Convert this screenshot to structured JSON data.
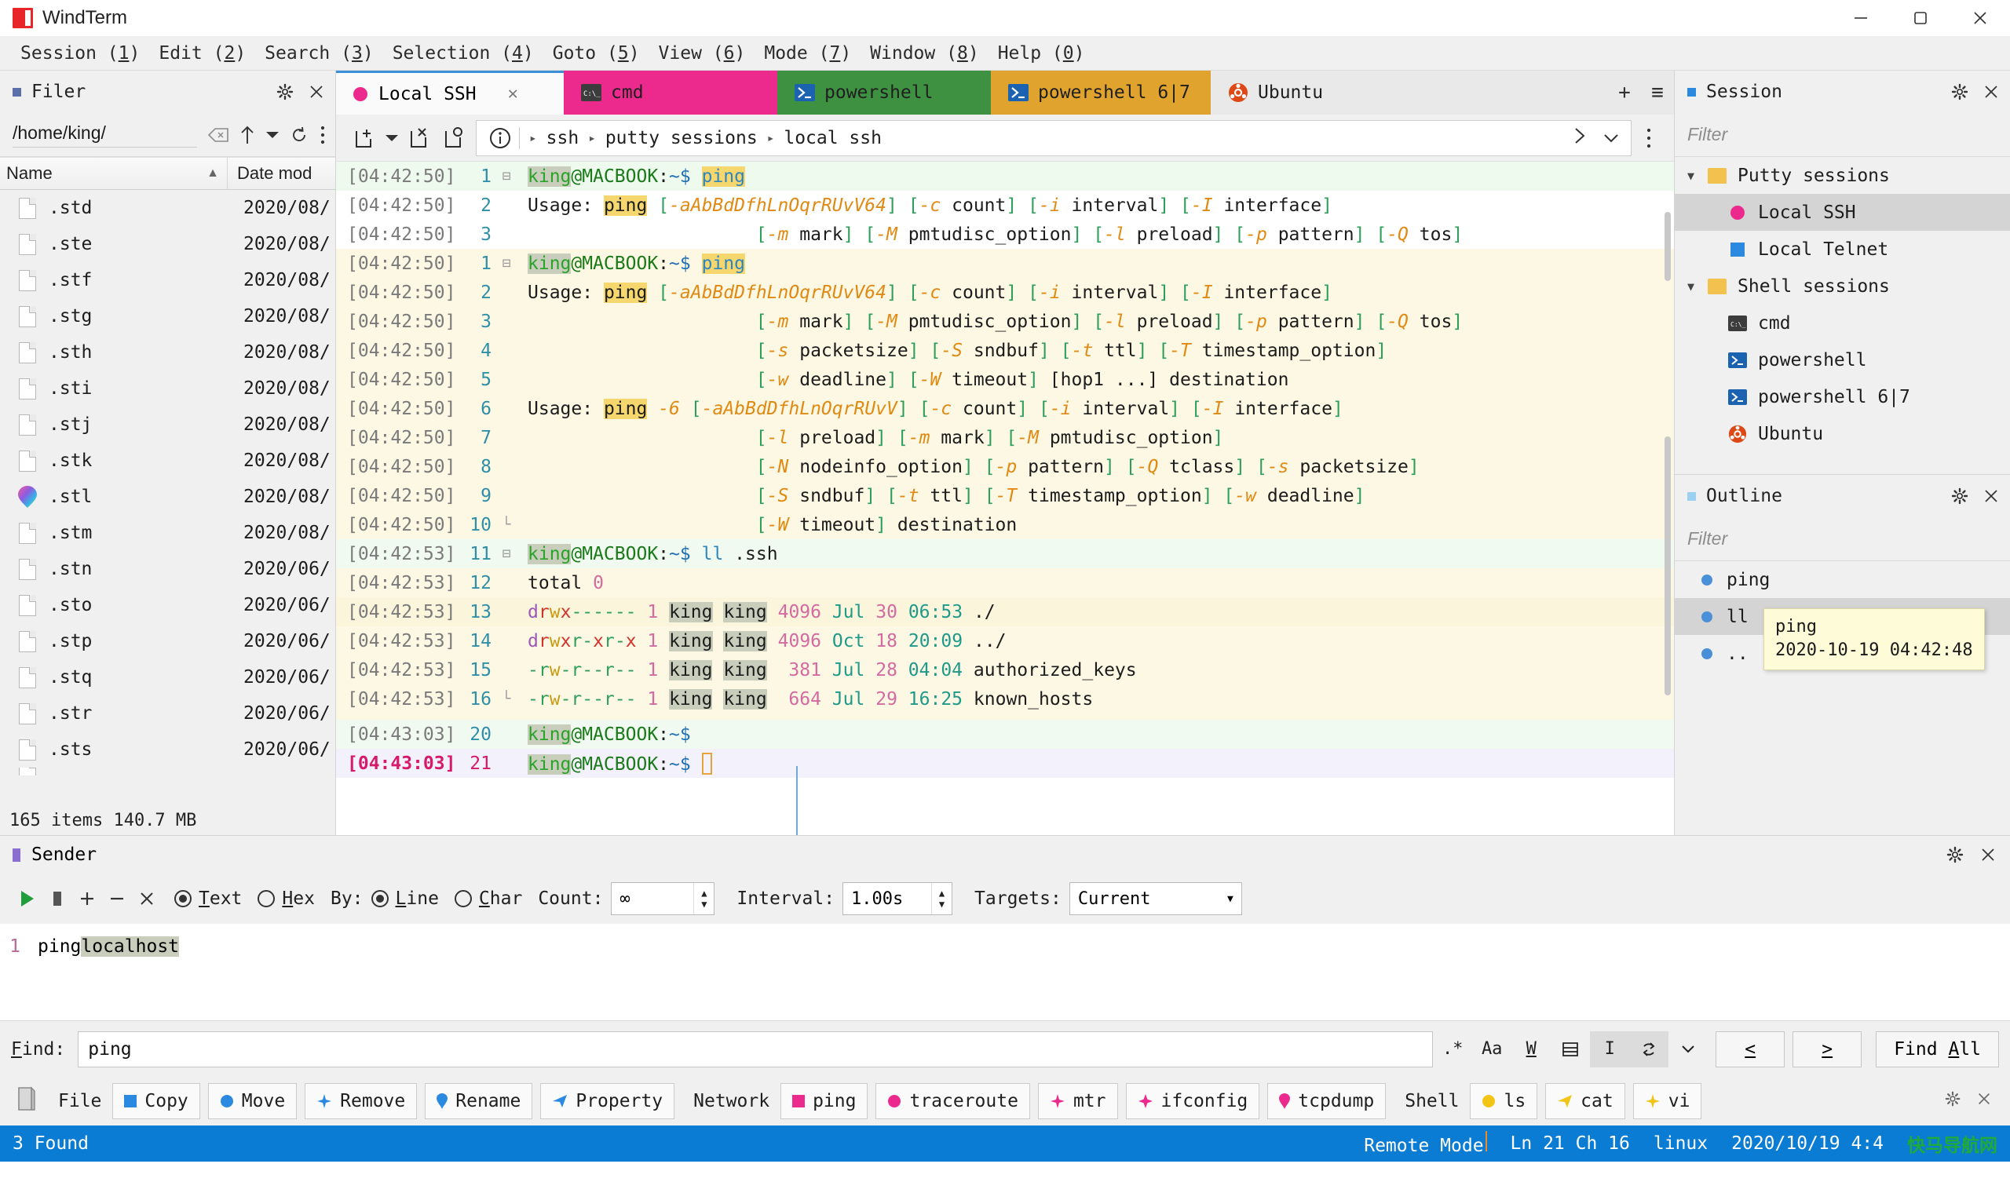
{
  "app": {
    "title": "WindTerm",
    "logo_icon": "windterm-logo-icon"
  },
  "window_controls": {
    "minimize": "minimize-icon",
    "maximize": "maximize-icon",
    "close": "close-icon"
  },
  "menubar": [
    {
      "label": "Session",
      "key": "1"
    },
    {
      "label": "Edit",
      "key": "2"
    },
    {
      "label": "Search",
      "key": "3"
    },
    {
      "label": "Selection",
      "key": "4"
    },
    {
      "label": "Goto",
      "key": "5"
    },
    {
      "label": "View",
      "key": "6"
    },
    {
      "label": "Mode",
      "key": "7"
    },
    {
      "label": "Window",
      "key": "8"
    },
    {
      "label": "Help",
      "key": "0"
    }
  ],
  "filer": {
    "title": "Filer",
    "path": "/home/king/",
    "columns": [
      "Name",
      "Date mod"
    ],
    "status": "165 items 140.7 MB",
    "files": [
      {
        "name": ".std",
        "date": "2020/08/",
        "icon": "file-icon"
      },
      {
        "name": ".ste",
        "date": "2020/08/",
        "icon": "file-icon"
      },
      {
        "name": ".stf",
        "date": "2020/08/",
        "icon": "file-icon"
      },
      {
        "name": ".stg",
        "date": "2020/08/",
        "icon": "file-icon"
      },
      {
        "name": ".sth",
        "date": "2020/08/",
        "icon": "file-icon"
      },
      {
        "name": ".sti",
        "date": "2020/08/",
        "icon": "file-icon"
      },
      {
        "name": ".stj",
        "date": "2020/08/",
        "icon": "file-icon"
      },
      {
        "name": ".stk",
        "date": "2020/08/",
        "icon": "file-icon"
      },
      {
        "name": ".stl",
        "date": "2020/08/",
        "icon": "balloon-icon"
      },
      {
        "name": ".stm",
        "date": "2020/08/",
        "icon": "file-icon"
      },
      {
        "name": ".stn",
        "date": "2020/06/",
        "icon": "file-icon"
      },
      {
        "name": ".sto",
        "date": "2020/06/",
        "icon": "file-icon"
      },
      {
        "name": ".stp",
        "date": "2020/06/",
        "icon": "file-icon"
      },
      {
        "name": ".stq",
        "date": "2020/06/",
        "icon": "file-icon"
      },
      {
        "name": ".str",
        "date": "2020/06/",
        "icon": "file-icon"
      },
      {
        "name": ".sts",
        "date": "2020/06/",
        "icon": "file-icon"
      }
    ]
  },
  "tabs": [
    {
      "label": "Local SSH",
      "icon": "pink-dot-icon",
      "color": "#ec2a8e",
      "bg": "#fafafa",
      "active": true,
      "closable": true
    },
    {
      "label": "cmd",
      "icon": "cmd-icon",
      "bg": "#ec2a8e",
      "active": false
    },
    {
      "label": "powershell",
      "icon": "powershell-icon",
      "bg": "#3f9142",
      "active": false
    },
    {
      "label": "powershell 6|7",
      "icon": "powershell-icon",
      "bg": "#e0a32e",
      "active": false
    },
    {
      "label": "Ubuntu",
      "icon": "ubuntu-icon",
      "bg": "#e9e9e9",
      "active": false
    }
  ],
  "tab_actions": {
    "add": "+",
    "menu": "≡"
  },
  "breadcrumb": {
    "icons": [
      "new-tab-icon",
      "close-tab-icon",
      "reopen-tab-icon",
      "info-icon"
    ],
    "path": [
      "ssh",
      "putty sessions",
      "local ssh"
    ],
    "expand": "chevron-right-icon",
    "dropdown": "chevron-down-icon",
    "more": "more-vertical-icon"
  },
  "terminal": {
    "prompt": "king@MACBOOK:~$",
    "lines": [
      {
        "ts": "[04:42:50]",
        "n": "1",
        "bg": "green",
        "fold": "minus",
        "type": "prompt",
        "cmd": "ping"
      },
      {
        "ts": "[04:42:50]",
        "n": "2",
        "bg": "white",
        "type": "usage",
        "text": "Usage: ping [-aAbBdDfhLnOqrRUvV64] [-c count] [-i interval] [-I interface]"
      },
      {
        "ts": "[04:42:50]",
        "n": "3",
        "bg": "white",
        "type": "cont",
        "text": "[-m mark] [-M pmtudisc_option] [-l preload] [-p pattern] [-Q tos]"
      },
      {
        "ts": "[04:42:50]",
        "n": "1",
        "bg": "cream",
        "fold": "minus",
        "type": "prompt",
        "cmd": "ping"
      },
      {
        "ts": "[04:42:50]",
        "n": "2",
        "bg": "cream",
        "type": "usage",
        "text": "Usage: ping [-aAbBdDfhLnOqrRUvV64] [-c count] [-i interval] [-I interface]"
      },
      {
        "ts": "[04:42:50]",
        "n": "3",
        "bg": "cream",
        "type": "cont",
        "text": "[-m mark] [-M pmtudisc_option] [-l preload] [-p pattern] [-Q tos]"
      },
      {
        "ts": "[04:42:50]",
        "n": "4",
        "bg": "cream",
        "type": "cont",
        "text": "[-s packetsize] [-S sndbuf] [-t ttl] [-T timestamp_option]"
      },
      {
        "ts": "[04:42:50]",
        "n": "5",
        "bg": "cream",
        "type": "cont",
        "text": "[-w deadline] [-W timeout] [hop1 ...] destination"
      },
      {
        "ts": "[04:42:50]",
        "n": "6",
        "bg": "cream",
        "type": "usage6",
        "text": "Usage: ping -6 [-aAbBdDfhLnOqrRUvV] [-c count] [-i interval] [-I interface]"
      },
      {
        "ts": "[04:42:50]",
        "n": "7",
        "bg": "cream",
        "type": "cont",
        "text": "[-l preload] [-m mark] [-M pmtudisc_option]"
      },
      {
        "ts": "[04:42:50]",
        "n": "8",
        "bg": "cream",
        "type": "cont",
        "text": "[-N nodeinfo_option] [-p pattern] [-Q tclass] [-s packetsize]"
      },
      {
        "ts": "[04:42:50]",
        "n": "9",
        "bg": "cream",
        "type": "cont",
        "text": "[-S sndbuf] [-t ttl] [-T timestamp_option] [-w deadline]"
      },
      {
        "ts": "[04:42:50]",
        "n": "10",
        "bg": "cream",
        "type": "cont",
        "text": "[-W timeout] destination"
      },
      {
        "ts": "[04:42:53]",
        "n": "11",
        "bg": "mint",
        "fold": "minus",
        "type": "prompt2",
        "cmd": "ll",
        "arg": ".ssh"
      },
      {
        "ts": "[04:42:53]",
        "n": "12",
        "bg": "cream",
        "type": "total",
        "text": "total 0"
      },
      {
        "ts": "[04:42:53]",
        "n": "13",
        "bg": "cream2",
        "type": "ls",
        "perm": "drwx------",
        "links": "1",
        "user": "king",
        "group": "king",
        "size": "4096",
        "mon": "Jul",
        "day": "30",
        "time": "06:53",
        "file": "./"
      },
      {
        "ts": "[04:42:53]",
        "n": "14",
        "bg": "cream",
        "type": "ls",
        "perm": "drwxr-xr-x",
        "links": "1",
        "user": "king",
        "group": "king",
        "size": "4096",
        "mon": "Oct",
        "day": "18",
        "time": "20:09",
        "file": "../"
      },
      {
        "ts": "[04:42:53]",
        "n": "15",
        "bg": "cream",
        "type": "ls",
        "perm": "-rw-r--r--",
        "links": "1",
        "user": "king",
        "group": "king",
        "size": "381",
        "mon": "Jul",
        "day": "28",
        "time": "04:04",
        "file": "authorized_keys"
      },
      {
        "ts": "[04:42:53]",
        "n": "16",
        "bg": "cream",
        "type": "ls",
        "perm": "-rw-r--r--",
        "links": "1",
        "user": "king",
        "group": "king",
        "size": "664",
        "mon": "Jul",
        "day": "29",
        "time": "16:25",
        "file": "known_hosts"
      },
      {
        "ts": "[04:43:03]",
        "n": "20",
        "bg": "mint",
        "type": "promptonly"
      },
      {
        "ts": "[04:43:03]",
        "n": "21",
        "bg": "lav",
        "current": true,
        "type": "promptcursor"
      }
    ]
  },
  "session_panel": {
    "title": "Session",
    "filter_placeholder": "Filter",
    "groups": [
      {
        "label": "Putty sessions",
        "expanded": true,
        "icon": "folder-icon",
        "items": [
          {
            "label": "Local SSH",
            "icon": "pink-dot-icon",
            "color": "#ec2a8e",
            "selected": true
          },
          {
            "label": "Local Telnet",
            "icon": "blue-square-icon",
            "color": "#2b8ae0",
            "selected": false
          }
        ]
      },
      {
        "label": "Shell sessions",
        "expanded": true,
        "icon": "folder-icon",
        "items": [
          {
            "label": "cmd",
            "icon": "cmd-icon",
            "selected": false
          },
          {
            "label": "powershell",
            "icon": "powershell-icon",
            "selected": false
          },
          {
            "label": "powershell 6|7",
            "icon": "powershell-icon",
            "selected": false
          },
          {
            "label": "Ubuntu",
            "icon": "ubuntu-icon",
            "selected": false
          }
        ]
      }
    ]
  },
  "outline_panel": {
    "title": "Outline",
    "filter_placeholder": "Filter",
    "items": [
      {
        "label": "ping",
        "selected": false
      },
      {
        "label": "ll",
        "selected": true
      },
      {
        "label": "..",
        "selected": false
      }
    ],
    "tooltip": {
      "line1": "ping",
      "line2": "2020-10-19 04:42:48"
    }
  },
  "sender": {
    "title": "Sender",
    "buttons": [
      "play-icon",
      "stop-icon",
      "add-icon",
      "remove-icon",
      "close-icon"
    ],
    "format": {
      "options": [
        "Text",
        "Hex"
      ],
      "selected": "Text"
    },
    "by_label": "By:",
    "by": {
      "options": [
        "Line",
        "Char"
      ],
      "selected": "Line"
    },
    "count_label": "Count:",
    "count_value": "∞",
    "interval_label": "Interval:",
    "interval_value": "1.00s",
    "targets_label": "Targets:",
    "targets_value": "Current",
    "editor": {
      "line_no": "1",
      "command": "ping ",
      "highlighted": "localhost"
    }
  },
  "find": {
    "label": "Find:",
    "value": "ping",
    "options": [
      {
        "name": "regex-icon",
        "glyph": ".*",
        "active": false
      },
      {
        "name": "match-case-icon",
        "glyph": "Aa",
        "active": false
      },
      {
        "name": "whole-word-icon",
        "glyph": "W",
        "active": false
      },
      {
        "name": "in-selection-icon",
        "glyph": "☰",
        "active": false
      },
      {
        "name": "cursor-icon",
        "glyph": "I",
        "active": true
      },
      {
        "name": "wrap-around-icon",
        "glyph": "↻",
        "active": true
      }
    ],
    "more": "chevron-down-icon",
    "prev": "<",
    "next": ">",
    "find_all": "Find All"
  },
  "quickbar": {
    "left_icon": "book-icon",
    "groups": [
      {
        "label": "File",
        "buttons": [
          {
            "label": "Copy",
            "icon": "blue-square-icon",
            "color": "#2b8ae0"
          },
          {
            "label": "Move",
            "icon": "blue-circle-icon",
            "color": "#2b8ae0"
          },
          {
            "label": "Remove",
            "icon": "blue-star-icon",
            "color": "#2b8ae0"
          },
          {
            "label": "Rename",
            "icon": "blue-pin-icon",
            "color": "#2b8ae0"
          },
          {
            "label": "Property",
            "icon": "blue-flag-icon",
            "color": "#2b8ae0"
          }
        ]
      },
      {
        "label": "Network",
        "buttons": [
          {
            "label": "ping",
            "icon": "pink-square-icon",
            "color": "#ec2a8e"
          },
          {
            "label": "traceroute",
            "icon": "pink-circle-icon",
            "color": "#ec2a8e"
          },
          {
            "label": "mtr",
            "icon": "pink-star-icon",
            "color": "#ec2a8e"
          },
          {
            "label": "ifconfig",
            "icon": "pink-star-icon",
            "color": "#ec2a8e"
          },
          {
            "label": "tcpdump",
            "icon": "pink-pin-icon",
            "color": "#ec2a8e"
          }
        ]
      },
      {
        "label": "Shell",
        "buttons": [
          {
            "label": "ls",
            "icon": "yellow-circle-icon",
            "color": "#f2c414"
          },
          {
            "label": "cat",
            "icon": "yellow-flag-icon",
            "color": "#f2c414"
          },
          {
            "label": "vi",
            "icon": "yellow-star-icon",
            "color": "#f2c414"
          }
        ]
      }
    ]
  },
  "statusbar": {
    "found": "3 Found",
    "mode": "Remote Mode",
    "position": "Ln 21 Ch 16",
    "platform": "linux",
    "datetime": "2020/10/19 4:4",
    "watermark": "快马导航网"
  },
  "colors": {
    "accent": "#0a7cd3",
    "tab_active_border": "#3a8fd6",
    "pink": "#ec2a8e",
    "green": "#3f9142",
    "orange": "#e0a32e"
  }
}
